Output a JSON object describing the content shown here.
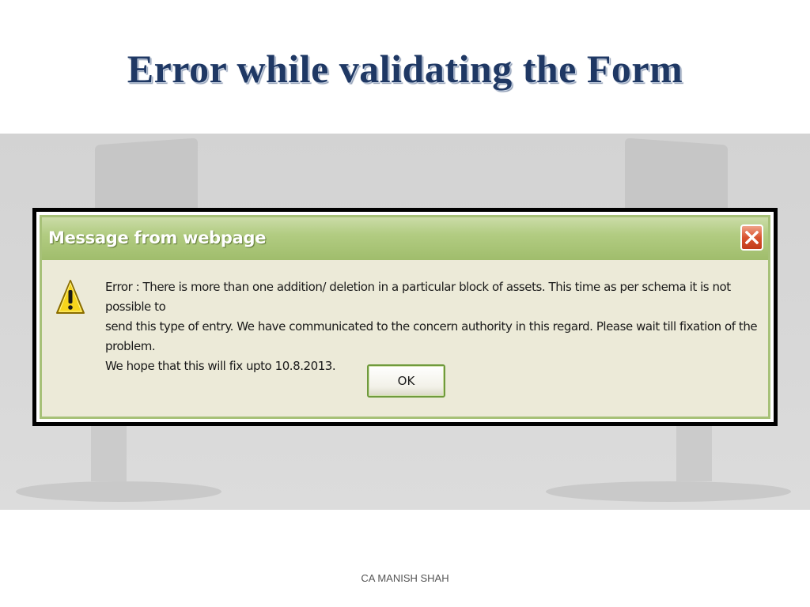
{
  "slide": {
    "title": "Error while validating the Form",
    "footer": "CA MANISH SHAH"
  },
  "dialog": {
    "title": "Message from webpage",
    "message": "Error : There is more than one addition/ deletion in a particular block of assets. This time as per schema it is not possible to\nsend this type of entry. We have communicated to the concern authority in this regard. Please wait till fixation of the problem.\nWe hope that this will fix upto 10.8.2013.",
    "ok_label": "OK",
    "icon": "warning-icon",
    "close_icon": "close-icon"
  },
  "colors": {
    "title_text": "#1f3864",
    "titlebar_green": "#a0bd6c",
    "dialog_body": "#ecead8",
    "close_red": "#d9532f",
    "warning_yellow": "#f7d51c"
  }
}
